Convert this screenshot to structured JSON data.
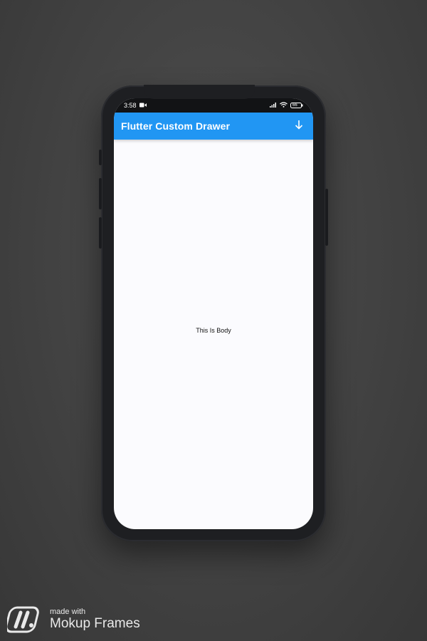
{
  "status_bar": {
    "time": "3:58",
    "battery": "66"
  },
  "app_bar": {
    "title": "Flutter Custom Drawer",
    "color": "#2196f3",
    "action_icon": "arrow-down-icon"
  },
  "body": {
    "text": "This Is Body"
  },
  "watermark": {
    "line1": "made with",
    "line2": "Mokup Frames"
  }
}
